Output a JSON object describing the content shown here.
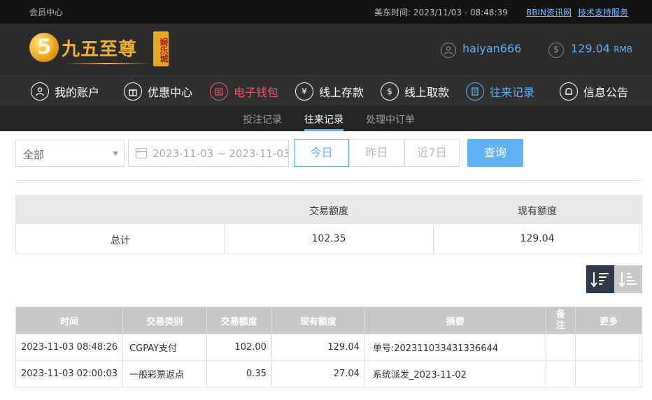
{
  "topbar": {
    "member_center": "会员中心",
    "clock": "美东时间: 2023/11/03 - 08:48:39",
    "news_link": "BBIN资讯网",
    "support_link": "技术支持服务"
  },
  "header": {
    "logo_digit": "5",
    "logo_text": "九五至尊",
    "logo_tag": "娱乐城",
    "username": "haiyan666",
    "balance": "129.04",
    "currency": "RMB"
  },
  "nav": {
    "items": [
      {
        "label": "我的账户",
        "icon": "user-icon"
      },
      {
        "label": "优惠中心",
        "icon": "gift-icon"
      },
      {
        "label": "电子钱包",
        "icon": "wallet-icon"
      },
      {
        "label": "线上存款",
        "icon": "deposit-icon"
      },
      {
        "label": "线上取款",
        "icon": "withdraw-icon"
      },
      {
        "label": "往来记录",
        "icon": "records-icon"
      },
      {
        "label": "信息公告",
        "icon": "bell-icon"
      }
    ],
    "colors": {
      "default": "#ffffff",
      "wallet": "#f0566b",
      "active": "#5fb3f5"
    }
  },
  "subtabs": [
    "投注记录",
    "往来记录",
    "处理中订单"
  ],
  "filters": {
    "type_selected": "全部",
    "date_range": "2023-11-03 ~ 2023-11-03",
    "range_buttons": [
      "今日",
      "昨日",
      "近7日"
    ],
    "query": "查询"
  },
  "summary": {
    "headers": [
      "",
      "交易额度",
      "现有额度"
    ],
    "row": [
      "总计",
      "102.35",
      "129.04"
    ]
  },
  "records": {
    "headers": [
      "时间",
      "交易类别",
      "交易额度",
      "现有额度",
      "摘要",
      "备注",
      "更多"
    ],
    "rows": [
      [
        "2023-11-03 08:48:26",
        "CGPAY支付",
        "102.00",
        "129.04",
        "单号:202311033431336644",
        "",
        ""
      ],
      [
        "2023-11-03 02:00:03",
        "一般彩票返点",
        "0.35",
        "27.04",
        "系统派发_2023-11-02",
        "",
        ""
      ]
    ]
  }
}
